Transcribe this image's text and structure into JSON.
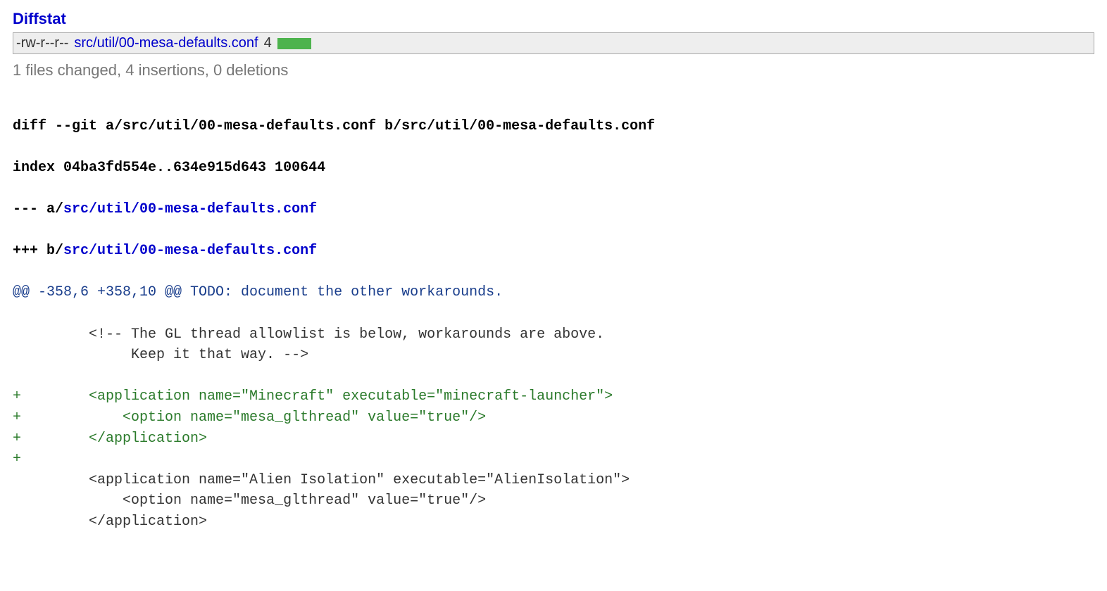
{
  "section_title": "Diffstat",
  "diffstat": {
    "rows": [
      {
        "mode": "-rw-r--r--",
        "file": "src/util/00-mesa-defaults.conf",
        "lines": "4",
        "insertions": 4,
        "deletions": 0
      }
    ]
  },
  "summary": "1 files changed, 4 insertions, 0 deletions",
  "diff": {
    "header_diff": "diff --git a/src/util/00-mesa-defaults.conf b/src/util/00-mesa-defaults.conf",
    "header_index": "index 04ba3fd554e..634e915d643 100644",
    "minus_prefix": "--- a/",
    "plus_prefix": "+++ b/",
    "path": "src/util/00-mesa-defaults.conf",
    "hunk": "@@ -358,6 +358,10 @@ TODO: document the other workarounds.",
    "lines": [
      {
        "t": "ctx",
        "s": "         <!-- The GL thread allowlist is below, workarounds are above."
      },
      {
        "t": "ctx",
        "s": "              Keep it that way. -->"
      },
      {
        "t": "ctx",
        "s": " "
      },
      {
        "t": "add",
        "s": "+        <application name=\"Minecraft\" executable=\"minecraft-launcher\">"
      },
      {
        "t": "add",
        "s": "+            <option name=\"mesa_glthread\" value=\"true\"/>"
      },
      {
        "t": "add",
        "s": "+        </application>"
      },
      {
        "t": "add",
        "s": "+"
      },
      {
        "t": "ctx",
        "s": "         <application name=\"Alien Isolation\" executable=\"AlienIsolation\">"
      },
      {
        "t": "ctx",
        "s": "             <option name=\"mesa_glthread\" value=\"true\"/>"
      },
      {
        "t": "ctx",
        "s": "         </application>"
      }
    ]
  }
}
